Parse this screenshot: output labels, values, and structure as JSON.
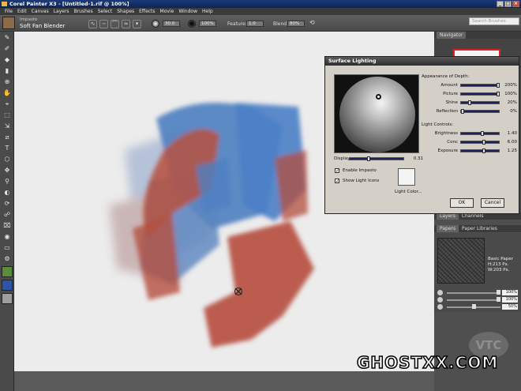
{
  "window": {
    "title": "Corel Painter X3 - [Untitled-1.rif @ 100%]",
    "buttons": [
      "_",
      "□",
      "×"
    ]
  },
  "menu": [
    "File",
    "Edit",
    "Canvas",
    "Layers",
    "Brushes",
    "Select",
    "Shapes",
    "Effects",
    "Movie",
    "Window",
    "Help"
  ],
  "search": {
    "placeholder": "Search Brushes"
  },
  "propbar": {
    "brush_category": "Impasto",
    "brush_variant": "Soft Fan Blender",
    "size_value": "30.0",
    "opacity_value": "100%",
    "feature_label": "Feature:",
    "feature_value": "1.0",
    "blend_label": "Blend:",
    "blend_value": "80%"
  },
  "toolbox": {
    "tools": [
      "✎",
      "✐",
      "◆",
      "▮",
      "⊕",
      "✋",
      "⌖",
      "⬚",
      "⇲",
      "⧄",
      "T",
      "⬡",
      "✥",
      "⚲",
      "◐",
      "⟳",
      "☍",
      "⌧",
      "◉",
      "▭",
      "⚙"
    ],
    "colors": {
      "main": "#5b8c3a",
      "secondary": "#2c55a8",
      "paper": "#9e9e9e"
    }
  },
  "panels": {
    "navigator_tab": "Navigator",
    "layers_tab": "Layers",
    "channels_tab": "Channels",
    "papers_tab": "Papers",
    "paper_libraries_tab": "Paper Libraries",
    "paper_name": "Basic Paper",
    "paper_h": "H:213 Px.",
    "paper_w": "W:203 Px.",
    "sliders": [
      "100%",
      "100%",
      "50%"
    ],
    "slider_levels": [
      1.0,
      1.0,
      0.5
    ]
  },
  "logo": "VTC",
  "dialog": {
    "title": "Surface Lighting",
    "depth_heading": "Appearance of Depth:",
    "depth_rows": [
      {
        "label": "Amount",
        "value": "200%",
        "level": 1.0
      },
      {
        "label": "Picture",
        "value": "100%",
        "level": 1.0
      },
      {
        "label": "Shine",
        "value": "20%",
        "level": 0.2
      },
      {
        "label": "Reflection",
        "value": "0%",
        "level": 0.0
      }
    ],
    "light_heading": "Light Controls:",
    "light_rows": [
      {
        "label": "Brightness",
        "value": "1.40",
        "level": 0.55
      },
      {
        "label": "Conc",
        "value": "6.00",
        "level": 0.6
      },
      {
        "label": "Exposure",
        "value": "1.25",
        "level": 0.6
      }
    ],
    "display_label": "Display",
    "display_value": "0.31",
    "enable_impasto": "Enable Impasto",
    "show_light_icons": "Show Light Icons",
    "light_color": "Light Color...",
    "ok": "OK",
    "cancel": "Cancel"
  },
  "watermark": "GHOSTXX.COM"
}
